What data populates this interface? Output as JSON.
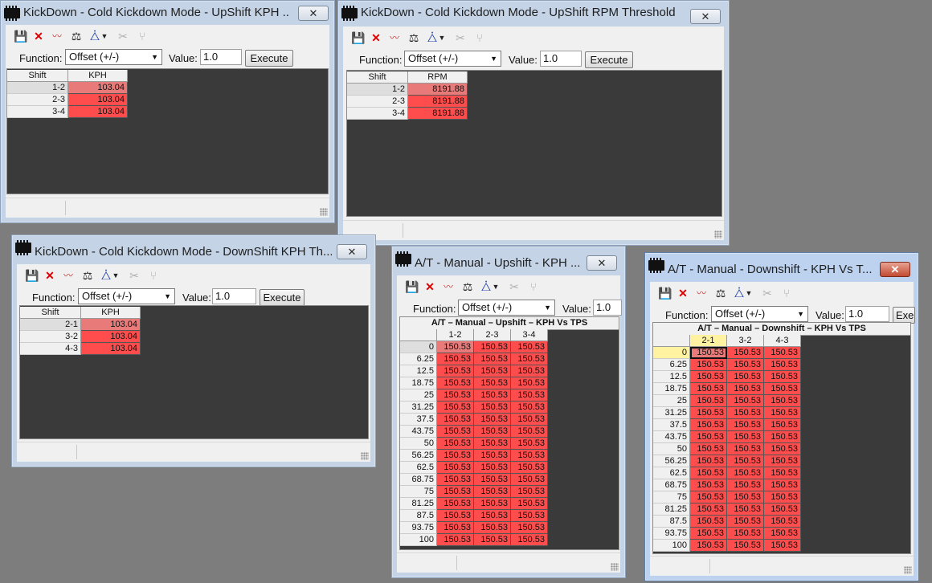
{
  "toolbar_icons": [
    "save-icon",
    "discard-icon",
    "graph-icon",
    "scale-icon",
    "triangle-icon",
    "dropdown-icon",
    "cut-icon",
    "fork-icon"
  ],
  "colors": {
    "value_cell": "#ff4d4d",
    "selected_cell": "#e87a7a",
    "grid_bg": "#3a3a3a",
    "highlight": "#fff2a0"
  },
  "windows": [
    {
      "title": "KickDown - Cold Kickdown Mode - UpShift KPH ...",
      "function_label": "Function:",
      "function_value": "Offset (+/-)",
      "value_label": "Value:",
      "value": "1.0",
      "execute": "Execute",
      "columns": [
        "Shift",
        "KPH"
      ],
      "rows": [
        {
          "label": "1-2",
          "value": "103.04"
        },
        {
          "label": "2-3",
          "value": "103.04"
        },
        {
          "label": "3-4",
          "value": "103.04"
        }
      ]
    },
    {
      "title": "KickDown - Cold Kickdown Mode - UpShift RPM Threshold",
      "function_label": "Function:",
      "function_value": "Offset (+/-)",
      "value_label": "Value:",
      "value": "1.0",
      "execute": "Execute",
      "columns": [
        "Shift",
        "RPM"
      ],
      "rows": [
        {
          "label": "1-2",
          "value": "8191.88"
        },
        {
          "label": "2-3",
          "value": "8191.88"
        },
        {
          "label": "3-4",
          "value": "8191.88"
        }
      ]
    },
    {
      "title": "KickDown - Cold Kickdown Mode - DownShift KPH Th...",
      "function_label": "Function:",
      "function_value": "Offset (+/-)",
      "value_label": "Value:",
      "value": "1.0",
      "execute": "Execute",
      "columns": [
        "Shift",
        "KPH"
      ],
      "rows": [
        {
          "label": "2-1",
          "value": "103.04"
        },
        {
          "label": "3-2",
          "value": "103.04"
        },
        {
          "label": "4-3",
          "value": "103.04"
        }
      ]
    },
    {
      "title": "A/T - Manual - Upshift - KPH ...",
      "function_label": "Function:",
      "function_value": "Offset (+/-)",
      "value_label": "Value:",
      "value": "1.0",
      "execute": "Execute",
      "table_title": "A/T – Manual – Upshift – KPH Vs TPS",
      "columns": [
        "1-2",
        "2-3",
        "3-4"
      ],
      "row_labels": [
        "0",
        "6.25",
        "12.5",
        "18.75",
        "25",
        "31.25",
        "37.5",
        "43.75",
        "50",
        "56.25",
        "62.5",
        "68.75",
        "75",
        "81.25",
        "87.5",
        "93.75",
        "100"
      ],
      "cell_value": "150.53"
    },
    {
      "title": "A/T - Manual - Downshift - KPH Vs T...",
      "function_label": "Function:",
      "function_value": "Offset (+/-)",
      "value_label": "Value:",
      "value": "1.0",
      "execute": "Exe",
      "table_title": "A/T – Manual – Downshift – KPH Vs TPS",
      "columns": [
        "2-1",
        "3-2",
        "4-3"
      ],
      "row_labels": [
        "0",
        "6.25",
        "12.5",
        "18.75",
        "25",
        "31.25",
        "37.5",
        "43.75",
        "50",
        "56.25",
        "62.5",
        "68.75",
        "75",
        "81.25",
        "87.5",
        "93.75",
        "100"
      ],
      "cell_value": "150.53"
    }
  ]
}
